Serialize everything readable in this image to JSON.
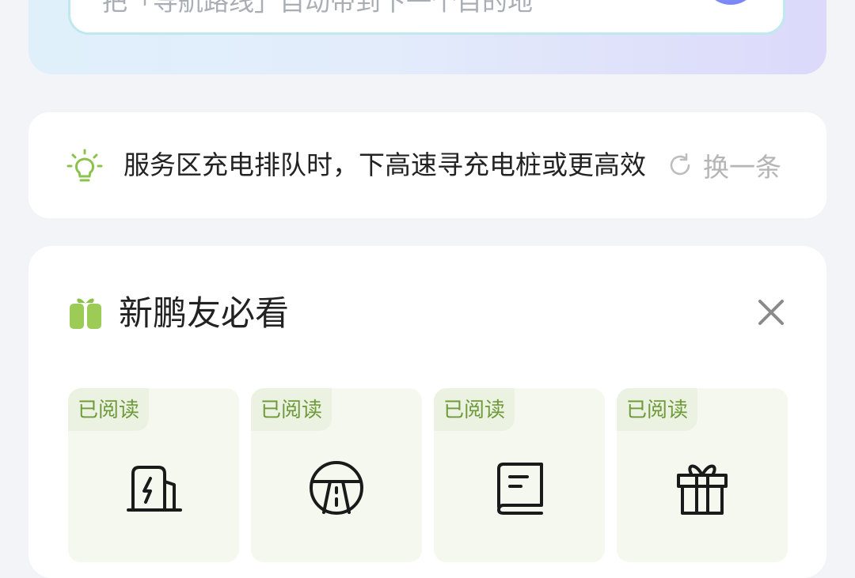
{
  "search": {
    "text": "把「导航路线」自动带到下一个目的地"
  },
  "tip": {
    "text": "服务区充电排队时，下高速寻充电桩或更高效",
    "refresh_label": "换一条",
    "icon": "lightbulb-icon"
  },
  "newbie": {
    "title": "新鹏友必看",
    "icon": "gift-icon",
    "close_icon": "close-icon",
    "items": [
      {
        "tag": "已阅读",
        "icon": "charging-pile-icon"
      },
      {
        "tag": "已阅读",
        "icon": "road-icon"
      },
      {
        "tag": "已阅读",
        "icon": "book-icon"
      },
      {
        "tag": "已阅读",
        "icon": "gift-icon"
      }
    ]
  },
  "colors": {
    "accent_green": "#8bc34a",
    "read_tag_text": "#6f9a3a",
    "tile_bg": "#f4f8ee"
  }
}
